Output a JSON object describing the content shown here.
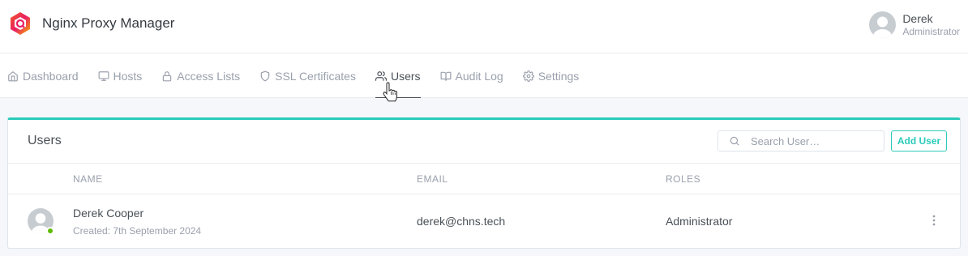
{
  "app": {
    "title": "Nginx Proxy Manager"
  },
  "current_user": {
    "name": "Derek",
    "role": "Administrator"
  },
  "nav": {
    "items": [
      {
        "label": "Dashboard",
        "icon": "home-icon"
      },
      {
        "label": "Hosts",
        "icon": "monitor-icon"
      },
      {
        "label": "Access Lists",
        "icon": "lock-icon"
      },
      {
        "label": "SSL Certificates",
        "icon": "shield-icon"
      },
      {
        "label": "Users",
        "icon": "users-icon",
        "active": true
      },
      {
        "label": "Audit Log",
        "icon": "book-icon"
      },
      {
        "label": "Settings",
        "icon": "gear-icon"
      }
    ]
  },
  "users_card": {
    "title": "Users",
    "search_placeholder": "Search User…",
    "add_button": "Add User",
    "columns": [
      "NAME",
      "EMAIL",
      "ROLES"
    ],
    "rows": [
      {
        "name": "Derek Cooper",
        "created": "Created: 7th September 2024",
        "email": "derek@chns.tech",
        "roles": "Administrator",
        "status": "online"
      }
    ]
  },
  "colors": {
    "accent": "#2bcbba",
    "status_online": "#5eba00",
    "text": "#495057",
    "muted": "#9aa0ac"
  }
}
